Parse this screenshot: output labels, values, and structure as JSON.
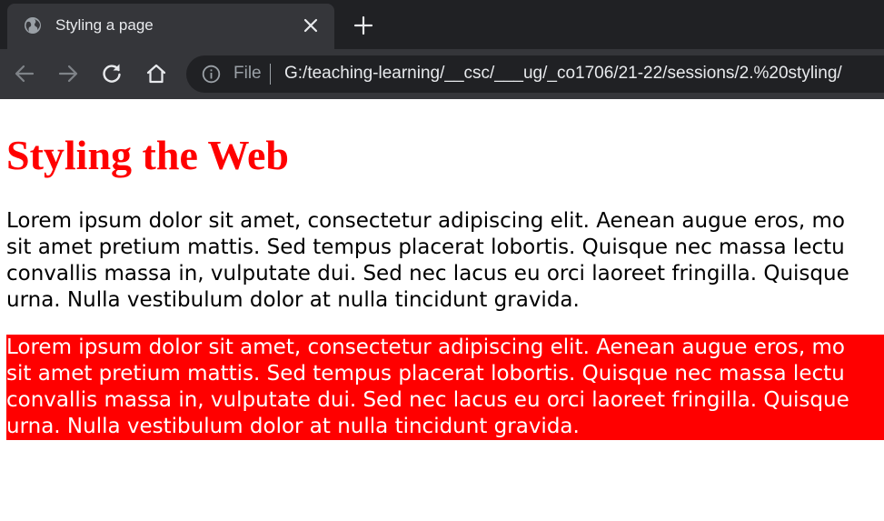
{
  "browser": {
    "tab": {
      "title": "Styling a page",
      "favicon": "globe-icon"
    },
    "toolbar": {
      "icons": [
        "back-arrow-icon",
        "forward-arrow-icon",
        "reload-icon",
        "home-icon"
      ],
      "omnibox": {
        "info_icon": "info-icon",
        "scheme_label": "File",
        "url": "G:/teaching-learning/__csc/___ug/_co1706/21-22/sessions/2.%20styling/"
      }
    },
    "colors": {
      "chrome_dark": "#202124",
      "chrome_mid": "#35363a",
      "chrome_text": "#e8eaed"
    }
  },
  "page": {
    "heading": "Styling the Web",
    "paragraphs": [
      {
        "lines": [
          "Lorem ipsum dolor sit amet, consectetur adipiscing elit. Aenean augue eros, mo",
          "sit amet pretium mattis. Sed tempus placerat lobortis. Quisque nec massa lectu",
          "convallis massa in, vulputate dui. Sed nec lacus eu orci laoreet fringilla. Quisque",
          "urna. Nulla vestibulum dolor at nulla tincidunt gravida."
        ]
      },
      {
        "lines": [
          "Lorem ipsum dolor sit amet, consectetur adipiscing elit. Aenean augue eros, mo",
          "sit amet pretium mattis. Sed tempus placerat lobortis. Quisque nec massa lectu",
          "convallis massa in, vulputate dui. Sed nec lacus eu orci laoreet fringilla. Quisque",
          "urna. Nulla vestibulum dolor at nulla tincidunt gravida."
        ]
      }
    ],
    "colors": {
      "heading": "#ff0000",
      "highlight_bg": "#ff0000",
      "highlight_text": "#ffffff"
    }
  }
}
